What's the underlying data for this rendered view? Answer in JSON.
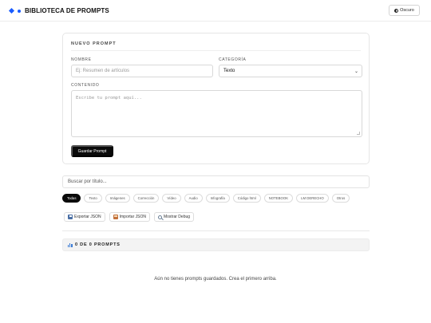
{
  "header": {
    "title": "BIBLIOTECA DE PROMPTS",
    "theme_button": "Oscuro",
    "brand_color": "#1a5cff"
  },
  "new_prompt": {
    "title": "NUEVO PROMPT",
    "name_label": "NOMBRE",
    "name_placeholder": "Ej: Resumen de artículos",
    "name_value": "",
    "category_label": "CATEGORÍA",
    "category_selected": "Texto",
    "content_label": "CONTENIDO",
    "content_placeholder": "Escribe tu prompt aquí...",
    "content_value": "",
    "save_button": "Guardar Prompt"
  },
  "search": {
    "placeholder": "Buscar por título...",
    "value": ""
  },
  "filters": [
    {
      "label": "Todas",
      "active": true
    },
    {
      "label": "Texto",
      "active": false
    },
    {
      "label": "Imágenes",
      "active": false
    },
    {
      "label": "Corrección",
      "active": false
    },
    {
      "label": "Vídeo",
      "active": false
    },
    {
      "label": "Audio",
      "active": false
    },
    {
      "label": "Infografía",
      "active": false
    },
    {
      "label": "Código html",
      "active": false
    },
    {
      "label": "NOTEBOOK",
      "active": false
    },
    {
      "label": "LM DERECHO",
      "active": false
    },
    {
      "label": "Otros",
      "active": false
    }
  ],
  "actions": {
    "export": {
      "label": "Exportar JSON",
      "icon": "floppy-disk-icon"
    },
    "import": {
      "label": "Importar JSON",
      "icon": "inbox-tray-icon"
    },
    "debug": {
      "label": "Mostrar Debug",
      "icon": "magnifier-icon"
    }
  },
  "count": {
    "label": "0 DE 0 PROMPTS",
    "icon": "bar-chart-icon"
  },
  "empty_message": "Aún no tienes prompts guardados. Crea el primero arriba."
}
